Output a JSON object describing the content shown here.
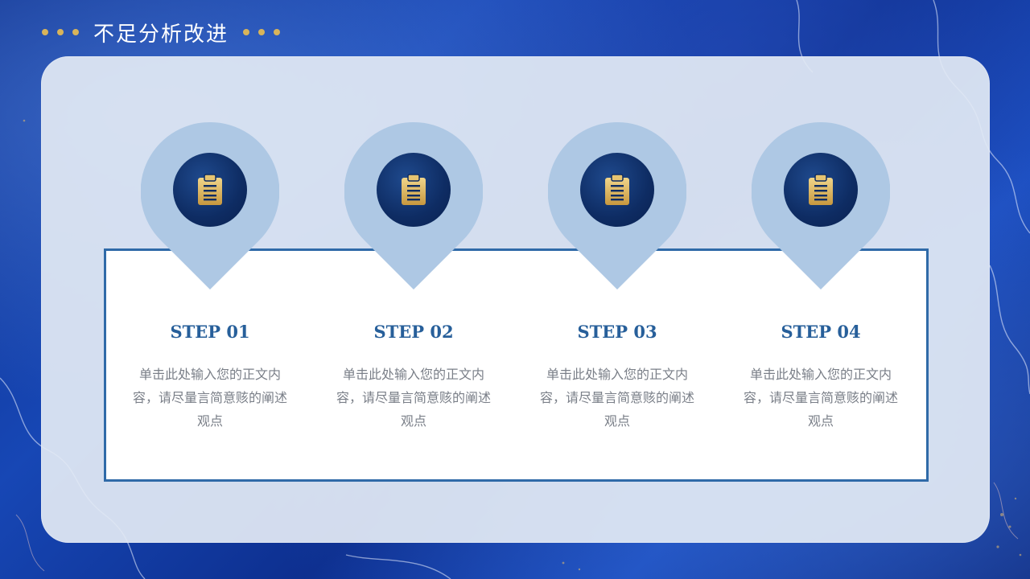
{
  "header": {
    "title": "不足分析改进",
    "accent_color": "#d8b45a"
  },
  "steps": [
    {
      "label": "STEP 01",
      "description": "单击此处输入您的正文内容，请尽量言简意赅的阐述观点",
      "icon": "clipboard-icon"
    },
    {
      "label": "STEP 02",
      "description": "单击此处输入您的正文内容，请尽量言简意赅的阐述观点",
      "icon": "clipboard-icon"
    },
    {
      "label": "STEP 03",
      "description": "单击此处输入您的正文内容，请尽量言简意赅的阐述观点",
      "icon": "clipboard-icon"
    },
    {
      "label": "STEP 04",
      "description": "单击此处输入您的正文内容，请尽量言简意赅的阐述观点",
      "icon": "clipboard-icon"
    }
  ],
  "colors": {
    "pin": "#aec8e4",
    "icon_gold": "#d8b45a",
    "frame_border": "#2f6aa8",
    "step_label": "#275f9a",
    "description": "#7a7f88"
  }
}
